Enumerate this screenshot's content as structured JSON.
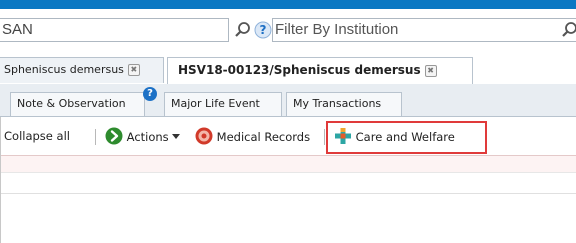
{
  "search": {
    "left_value": "SAN",
    "institution_placeholder": "Filter By Institution"
  },
  "record_tabs": [
    {
      "label": "Spheniscus demersus",
      "close": "✖"
    },
    {
      "label": "HSV18-00123/Spheniscus demersus",
      "close": "✖"
    }
  ],
  "sub_tabs": [
    {
      "label": "Note & Observation"
    },
    {
      "label": "Major Life Event"
    },
    {
      "label": "My Transactions"
    }
  ],
  "toolbar": {
    "collapse_all": "Collapse all",
    "actions": "Actions",
    "medical_records": "Medical Records",
    "care_and_welfare": "Care and Welfare"
  },
  "colors": {
    "accent_blue": "#0b78c3",
    "highlight_red": "#e03a3a"
  },
  "icons": {
    "search": "magnifier-icon",
    "help": "question-icon",
    "actions": "arrow-right-icon",
    "medical": "medical-icon",
    "care": "care-welfare-icon"
  }
}
